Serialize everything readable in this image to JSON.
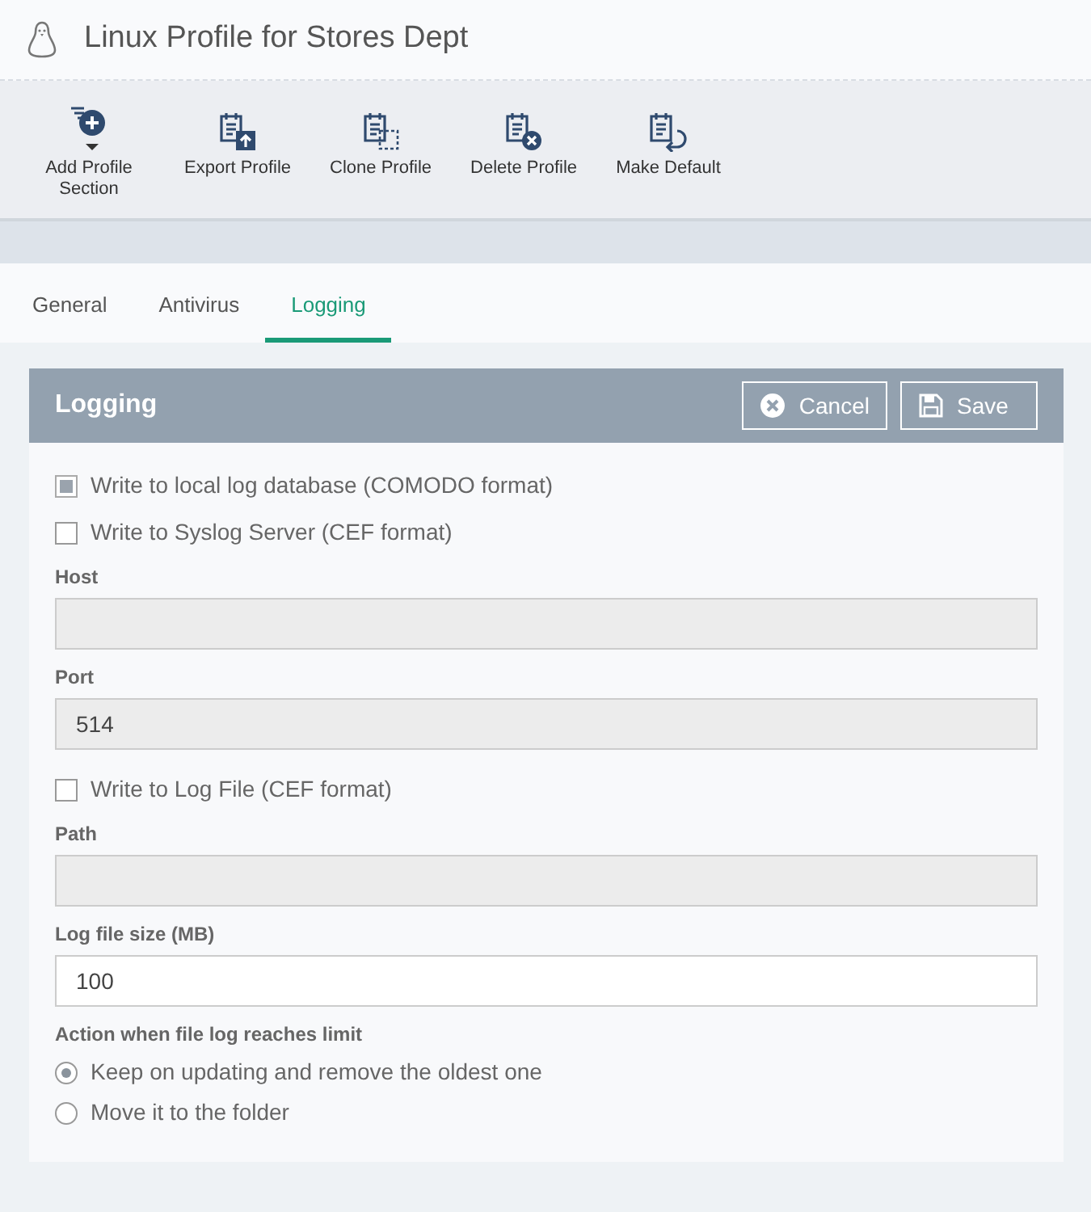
{
  "window": {
    "title": "Linux Profile for Stores Dept"
  },
  "toolbar": [
    {
      "label": "Add Profile Section",
      "kind": "add"
    },
    {
      "label": "Export Profile",
      "kind": "export"
    },
    {
      "label": "Clone Profile",
      "kind": "clone"
    },
    {
      "label": "Delete Profile",
      "kind": "delete"
    },
    {
      "label": "Make Default",
      "kind": "default"
    }
  ],
  "tabs": [
    {
      "label": "General",
      "selected": false
    },
    {
      "label": "Antivirus",
      "selected": false
    },
    {
      "label": "Logging",
      "selected": true
    }
  ],
  "panel": {
    "title": "Logging",
    "buttons": [
      {
        "label": "Cancel",
        "kind": "cancel"
      },
      {
        "label": "Save",
        "kind": "save"
      }
    ],
    "items": [
      {
        "kind": "checkbox",
        "label": "Write to local log database (COMODO format)",
        "checked": true,
        "disabled": true
      },
      {
        "kind": "checkbox",
        "label": "Write to Syslog Server (CEF format)",
        "checked": false,
        "disabled": false
      },
      {
        "kind": "field",
        "label": "Host",
        "disabled": true
      },
      {
        "kind": "field",
        "label": "Port",
        "value": "514",
        "disabled": true
      },
      {
        "kind": "checkbox",
        "label": "Write to Log File (CEF format)",
        "checked": false,
        "disabled": false
      },
      {
        "kind": "field",
        "label": "Path",
        "disabled": true
      },
      {
        "kind": "field",
        "label": "Log file size (MB)",
        "value": "100",
        "disabled": false
      },
      {
        "kind": "radios",
        "label": "Action when file log reaches limit",
        "options": [
          {
            "label": "Keep on updating and remove the oldest one",
            "selected": true
          },
          {
            "label": "Move it to the folder",
            "selected": false
          }
        ]
      }
    ]
  }
}
